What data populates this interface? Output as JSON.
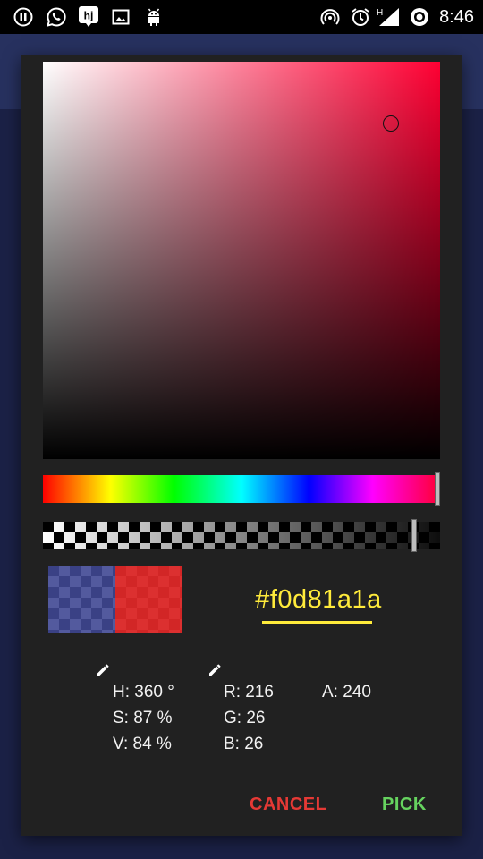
{
  "status_bar": {
    "time": "8:46",
    "network_label": "H",
    "left_icons": [
      "pause-icon",
      "whatsapp-icon",
      "hotjar-icon",
      "image-icon",
      "android-icon"
    ],
    "right_icons": [
      "hotspot-icon",
      "alarm-icon",
      "signal-icon",
      "sync-icon"
    ]
  },
  "color_picker": {
    "hue_color": "#ff0033",
    "hex_value": "#f0d81a1a",
    "old_color": "#1a237e",
    "new_color": "#d81a1a",
    "alpha_fraction": 0.94,
    "hue_fraction": 1.0,
    "hsv": {
      "h": "H: 360 °",
      "s": "S: 87 %",
      "v": "V: 84 %"
    },
    "rgb": {
      "r": "R: 216",
      "g": "G: 26",
      "b": "B: 26"
    },
    "alpha": {
      "a": "A: 240"
    }
  },
  "actions": {
    "cancel": "CANCEL",
    "pick": "PICK"
  }
}
